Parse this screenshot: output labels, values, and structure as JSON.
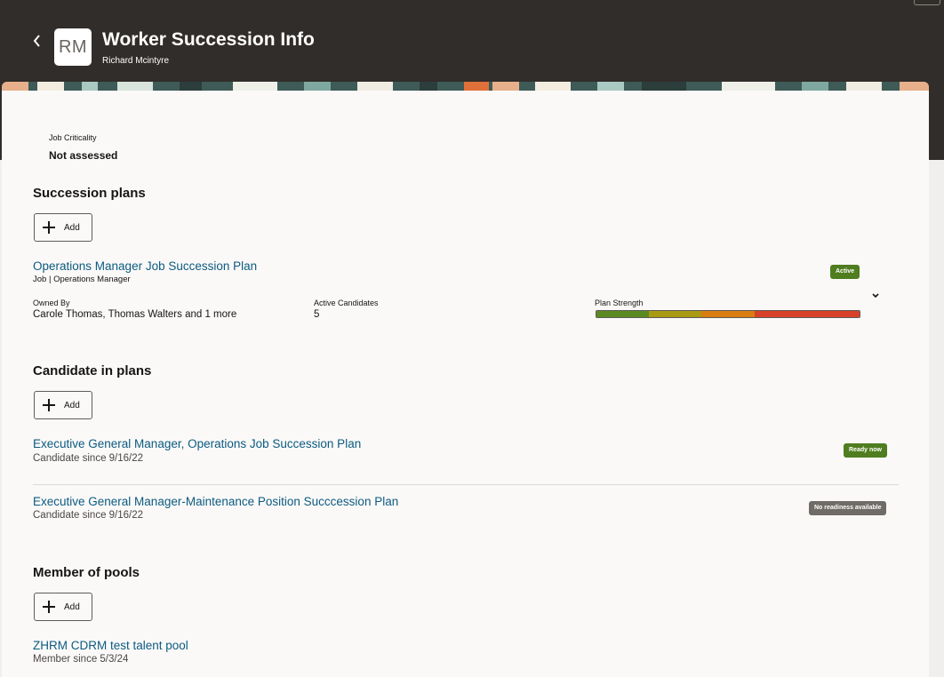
{
  "header": {
    "title": "Worker Succession Info",
    "subtitle": "Richard Mcintyre",
    "avatar_initials": "RM",
    "back_icon": "chevron-left-icon"
  },
  "job_criticality": {
    "label": "Job Criticality",
    "value": "Not assessed"
  },
  "succession_plans": {
    "title": "Succession plans",
    "add_label": "Add",
    "plan": {
      "name": "Operations Manager Job Succession Plan",
      "type_line": "Job | Operations Manager",
      "status": "Active",
      "owned_by_label": "Owned By",
      "owned_by_value": "Carole Thomas, Thomas Walters and 1 more",
      "active_candidates_label": "Active Candidates",
      "active_candidates_value": "5",
      "plan_strength_label": "Plan Strength",
      "strength_segments": [
        {
          "color": "#5b8a22",
          "fraction": 0.2
        },
        {
          "color": "#a89a12",
          "fraction": 0.2
        },
        {
          "color": "#d97c12",
          "fraction": 0.2
        },
        {
          "color": "#d9402a",
          "fraction": 0.4
        }
      ]
    }
  },
  "candidate_in_plans": {
    "title": "Candidate in plans",
    "add_label": "Add",
    "items": [
      {
        "name": "Executive General Manager, Operations Job Succession Plan",
        "since": "Candidate since 9/16/22",
        "readiness": "Ready now",
        "color": "#4f7d1f"
      },
      {
        "name": "Executive General Manager-Maintenance Position Succcession Plan",
        "since": "Candidate since 9/16/22",
        "readiness": "No readiness available",
        "color": "#6f6b67"
      }
    ]
  },
  "member_of_pools": {
    "title": "Member of pools",
    "add_label": "Add",
    "items": [
      {
        "name": "ZHRM CDRM test talent pool",
        "since": "Member since 5/3/24"
      }
    ]
  },
  "colors": {
    "header_bg": "#312d2a",
    "link": "#0b5b80",
    "active_badge": "#4f7d1f"
  }
}
